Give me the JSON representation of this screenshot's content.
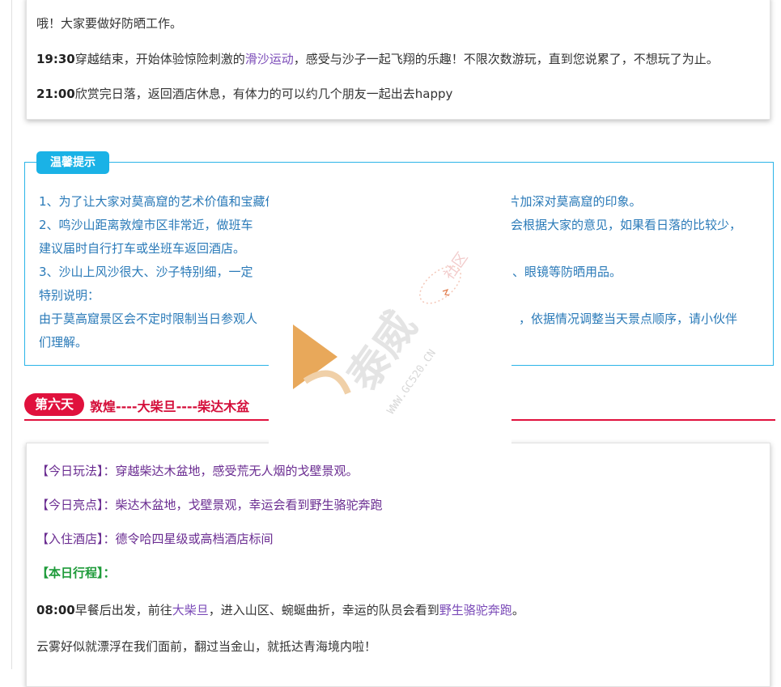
{
  "card1": {
    "line1": "哦！大家要做好防晒工作。",
    "line2_time": "19:30",
    "line2_a": "穿越结束，开始体验惊险刺激的",
    "line2_highlight": "滑沙运动",
    "line2_b": "，感受与沙子一起飞翔的乐趣！不限次数游玩，直到您说累了，不想玩了为止。",
    "line3_time": "21:00",
    "line3_text": "欣赏完日落，返回酒店休息，有体力的可以约几个朋友一起出去happy"
  },
  "tips": {
    "tag": "温馨提示",
    "lines": [
      "1、为了让大家对莫高窟的艺术价值和宝藏价值更深入的了解，在参观之前会先看两个短片加深对莫高窟的印象。",
      "2、鸣沙山距离敦煌市区非常近，做班车",
      "会根据大家的意见，如果看日落的比较少，",
      "建议届时自行打车或坐班车返回酒店。",
      "3、沙山上风沙很大、沙子特别细，一定",
      "、眼镜等防晒用品。",
      "特别说明：",
      "由于莫高窟景区会不定时限制当日参观人",
      "，依据情况调整当天景点顺序，请小伙伴",
      "们理解。"
    ]
  },
  "day": {
    "badge": "第六天",
    "route": "敦煌----大柴旦----柴达木盆"
  },
  "card2": {
    "play_label": "【今日玩法】",
    "play_text": "：穿越柴达木盆地，感受荒无人烟的戈壁景观。",
    "highlight_label": "【今日亮点】",
    "highlight_text": "：柴达木盆地，戈壁景观，幸运会看到野生骆驼奔跑",
    "hotel_label": "【入住酒店】",
    "hotel_text": "：德令哈四星级或高档酒店标间",
    "itinerary_label": "【本日行程】：",
    "l1_time": "08:00",
    "l1_a": "早餐后出发，前往",
    "l1_place": "大柴旦",
    "l1_b": "，进入山区、蜿蜒曲折，幸运的队员会看到",
    "l1_highlight": "野生骆驼奔跑",
    "l1_end": "。",
    "l2": "云雾好似就漂浮在我们面前，翻过当金山，就抵达青海境内啦！"
  },
  "watermark": {
    "brand": "泰威",
    "side": "社区",
    "url": "WWW.GC520.CN"
  },
  "colors": {
    "accent_blue": "#1ab2e6",
    "accent_red": "#e0113d",
    "purple": "#7b4bb8",
    "green": "#1e9b3a"
  }
}
